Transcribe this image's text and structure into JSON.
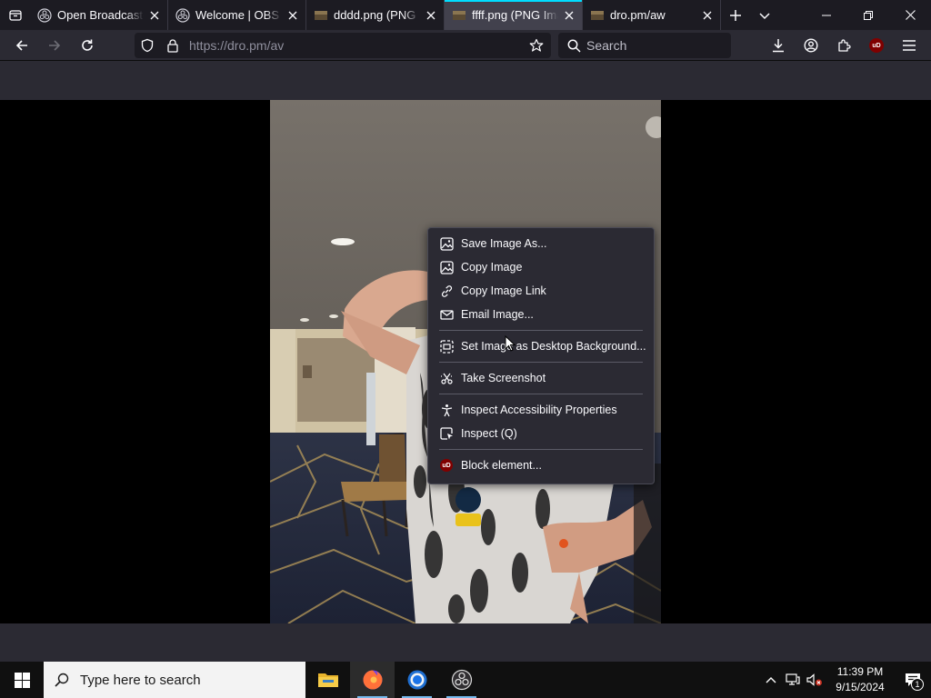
{
  "browser": {
    "tabs": [
      {
        "title": "Open Broadcaster",
        "favicon": "obs-icon",
        "active": false
      },
      {
        "title": "Welcome | OBS",
        "favicon": "obs-icon",
        "active": false
      },
      {
        "title": "dddd.png (PNG Im",
        "favicon": "image-icon",
        "active": false
      },
      {
        "title": "ffff.png (PNG Imag",
        "favicon": "image-icon",
        "active": true
      },
      {
        "title": "dro.pm/aw",
        "favicon": "image-icon",
        "active": false
      }
    ],
    "url": "https://dro.pm/av",
    "search_placeholder": "Search",
    "accent_color": "#00ddff"
  },
  "context_menu": {
    "items": [
      {
        "label": "Save Image As...",
        "icon": "image-icon"
      },
      {
        "label": "Copy Image",
        "icon": "image-icon"
      },
      {
        "label": "Copy Image Link",
        "icon": "link-icon"
      },
      {
        "label": "Email Image...",
        "icon": "envelope-icon"
      },
      {
        "label": "Set Image as Desktop Background...",
        "icon": "desktop-background-icon"
      },
      {
        "label": "Take Screenshot",
        "icon": "screenshot-icon"
      },
      {
        "label": "Inspect Accessibility Properties",
        "icon": "accessibility-icon"
      },
      {
        "label": "Inspect (Q)",
        "icon": "inspect-icon"
      },
      {
        "label": "Block element...",
        "icon": "ublock-icon"
      }
    ]
  },
  "taskbar": {
    "search_placeholder": "Type here to search",
    "apps": [
      "file-explorer-icon",
      "firefox-icon",
      "chrome-icon",
      "obs-icon"
    ],
    "time": "11:39 PM",
    "date": "9/15/2024",
    "notification_count": "1"
  }
}
